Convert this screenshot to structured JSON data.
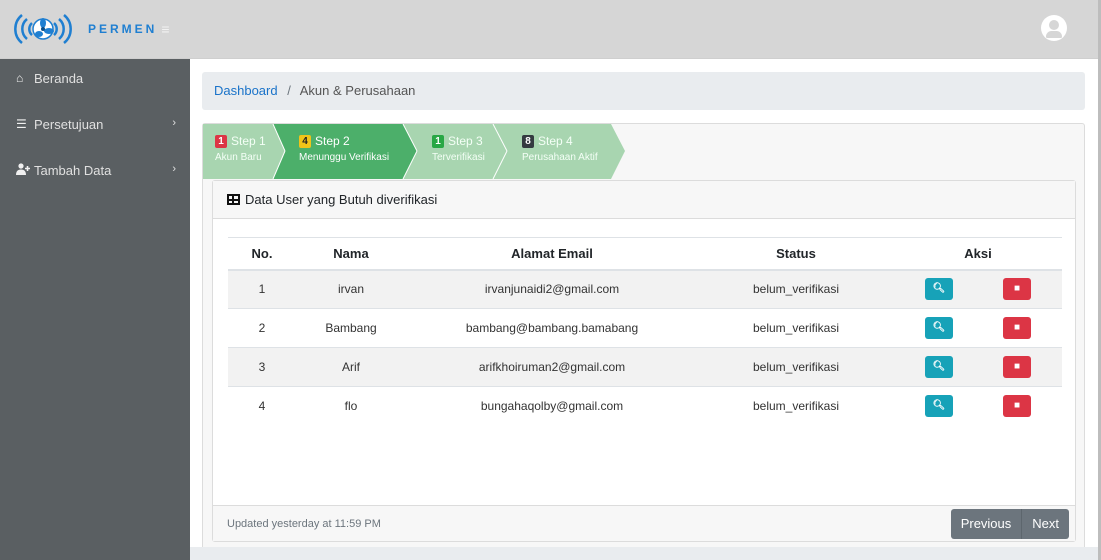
{
  "brand": {
    "name": "PERMEN",
    "logo_icon": "wireless-fan-logo-icon",
    "menu_icon": "hamburger-icon"
  },
  "header": {
    "user_icon": "user-circle-icon"
  },
  "sidebar": {
    "items": [
      {
        "label": "Beranda",
        "icon": "home-icon",
        "has_arrow": false
      },
      {
        "label": "Persetujuan",
        "icon": "list-icon",
        "has_arrow": true
      },
      {
        "label": "Tambah Data",
        "icon": "user-plus-icon",
        "has_arrow": true
      }
    ]
  },
  "breadcrumb": {
    "link": "Dashboard",
    "separator": "/",
    "current": "Akun & Perusahaan"
  },
  "steps": [
    {
      "count": "1",
      "title": "Step 1",
      "subtitle": "Akun Baru",
      "bg": "#a8d5b0",
      "badge": "#dc3545",
      "active": false
    },
    {
      "count": "4",
      "title": "Step 2",
      "subtitle": "Menunggu Verifikasi",
      "bg": "#4caf6a",
      "badge": "#f0c419",
      "active": true
    },
    {
      "count": "1",
      "title": "Step 3",
      "subtitle": "Terverifikasi",
      "bg": "#a8d5b0",
      "badge": "#28a745",
      "active": false
    },
    {
      "count": "8",
      "title": "Step 4",
      "subtitle": "Perusahaan Aktif",
      "bg": "#a8d5b0",
      "badge": "#343a40",
      "active": false
    }
  ],
  "card": {
    "title": "Data User yang Butuh diverifikasi",
    "title_icon": "table-icon",
    "footer": "Updated yesterday at 11:59 PM"
  },
  "table": {
    "headers": [
      "No.",
      "Nama",
      "Alamat Email",
      "Status",
      "Aksi"
    ],
    "rows": [
      {
        "no": "1",
        "nama": "irvan",
        "email": "irvanjunaidi2@gmail.com",
        "status": "belum_verifikasi"
      },
      {
        "no": "2",
        "nama": "Bambang",
        "email": "bambang@bambang.bamabang",
        "status": "belum_verifikasi"
      },
      {
        "no": "3",
        "nama": "Arif",
        "email": "arifkhoiruman2@gmail.com",
        "status": "belum_verifikasi"
      },
      {
        "no": "4",
        "nama": "flo",
        "email": "bungahaqolby@gmail.com",
        "status": "belum_verifikasi"
      }
    ],
    "view_icon": "search-icon",
    "delete_icon": "trash-icon"
  },
  "pagination": {
    "previous": "Previous",
    "next": "Next"
  },
  "colors": {
    "info": "#17a2b8",
    "danger": "#dc3545",
    "sidebar": "#5a5f62",
    "link": "#1a73c9"
  }
}
